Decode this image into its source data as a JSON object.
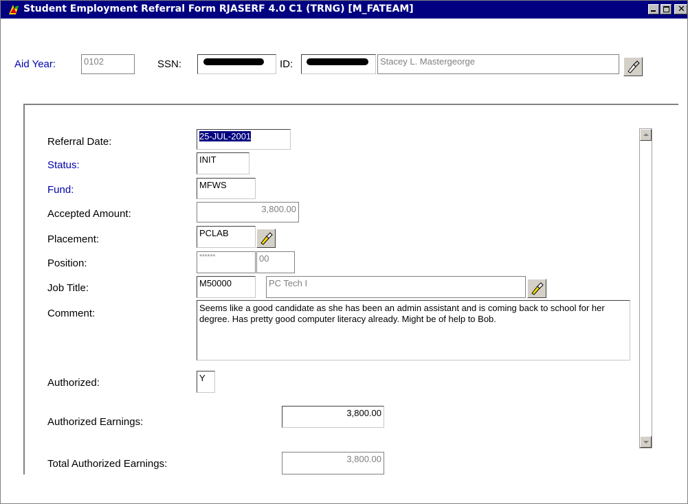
{
  "window": {
    "title": "Student Employment Referral Form   RJASERF  4.0 C1  (TRNG) [M_FATEAM]",
    "close_glyph": "✕"
  },
  "key_block": {
    "aid_year_label": "Aid Year:",
    "aid_year_value": "0102",
    "ssn_label": "SSN:",
    "ssn_value_masked": true,
    "id_label": "ID:",
    "id_value_masked": true,
    "name_value": "Stacey L. Mastergeorge"
  },
  "form": {
    "referral_date_label": "Referral Date:",
    "referral_date_value": "25-JUL-2001",
    "status_label": "Status:",
    "status_value": "INIT",
    "fund_label": "Fund:",
    "fund_value": "MFWS",
    "accepted_amount_label": "Accepted Amount:",
    "accepted_amount_value": "3,800.00",
    "placement_label": "Placement:",
    "placement_value": "PCLAB",
    "position_label": "Position:",
    "position_value": "******",
    "position_suffix_value": "00",
    "job_title_label": "Job Title:",
    "job_title_code": "M50000",
    "job_title_desc": "PC Tech I",
    "comment_label": "Comment:",
    "comment_value": "Seems like a good candidate as she has been an admin assistant and is coming back to school for her degree.  Has pretty good computer literacy already.  Might be of help to Bob.",
    "authorized_label": "Authorized:",
    "authorized_value": "Y",
    "authorized_earnings_label": "Authorized Earnings:",
    "authorized_earnings_value": "3,800.00",
    "total_authorized_earnings_label": "Total Authorized Earnings:",
    "total_authorized_earnings_value": "3,800.00"
  },
  "colors": {
    "titlebar": "#000080",
    "required_label": "#0000aa",
    "readonly_text": "#808080"
  },
  "icons": {
    "app": "app-icon",
    "search": "flashlight-search-icon"
  }
}
